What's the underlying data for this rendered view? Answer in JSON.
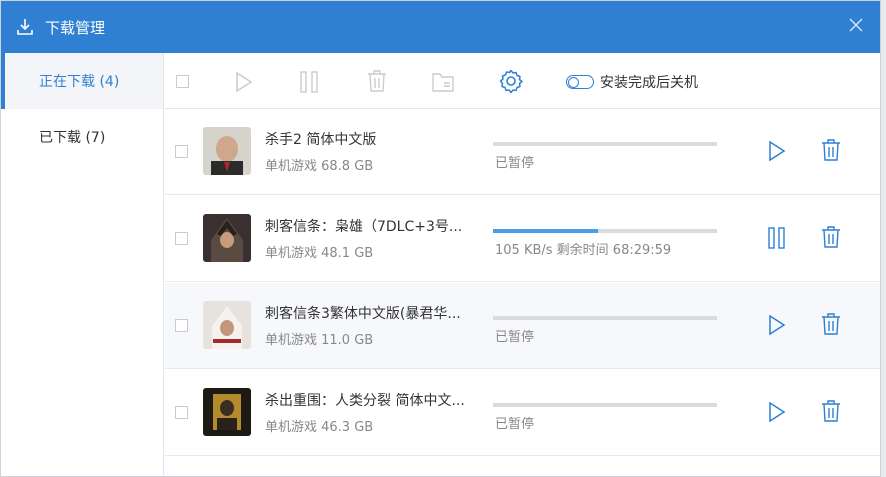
{
  "window": {
    "title": "下载管理"
  },
  "sidebar": {
    "items": [
      {
        "label": "正在下载 (4)",
        "active": true
      },
      {
        "label": "已下载 (7)",
        "active": false
      }
    ]
  },
  "toolbar": {
    "toggle_label": "安装完成后关机"
  },
  "colors": {
    "accent": "#2f7fd3",
    "progress": "#4a9ee6"
  },
  "downloads": [
    {
      "name": "杀手2 简体中文版",
      "meta": "单机游戏 68.8 GB",
      "status": "已暂停",
      "progress": 0,
      "state": "paused"
    },
    {
      "name": "刺客信条：枭雄（7DLC+3号...",
      "meta": "单机游戏 48.1 GB",
      "status": "105 KB/s 剩余时间 68:29:59",
      "progress": 0.47,
      "state": "downloading"
    },
    {
      "name": "刺客信条3繁体中文版(暴君华...",
      "meta": "单机游戏 11.0 GB",
      "status": "已暂停",
      "progress": 0,
      "state": "paused"
    },
    {
      "name": "杀出重围：人类分裂 简体中文...",
      "meta": "单机游戏 46.3 GB",
      "status": "已暂停",
      "progress": 0,
      "state": "paused"
    }
  ]
}
